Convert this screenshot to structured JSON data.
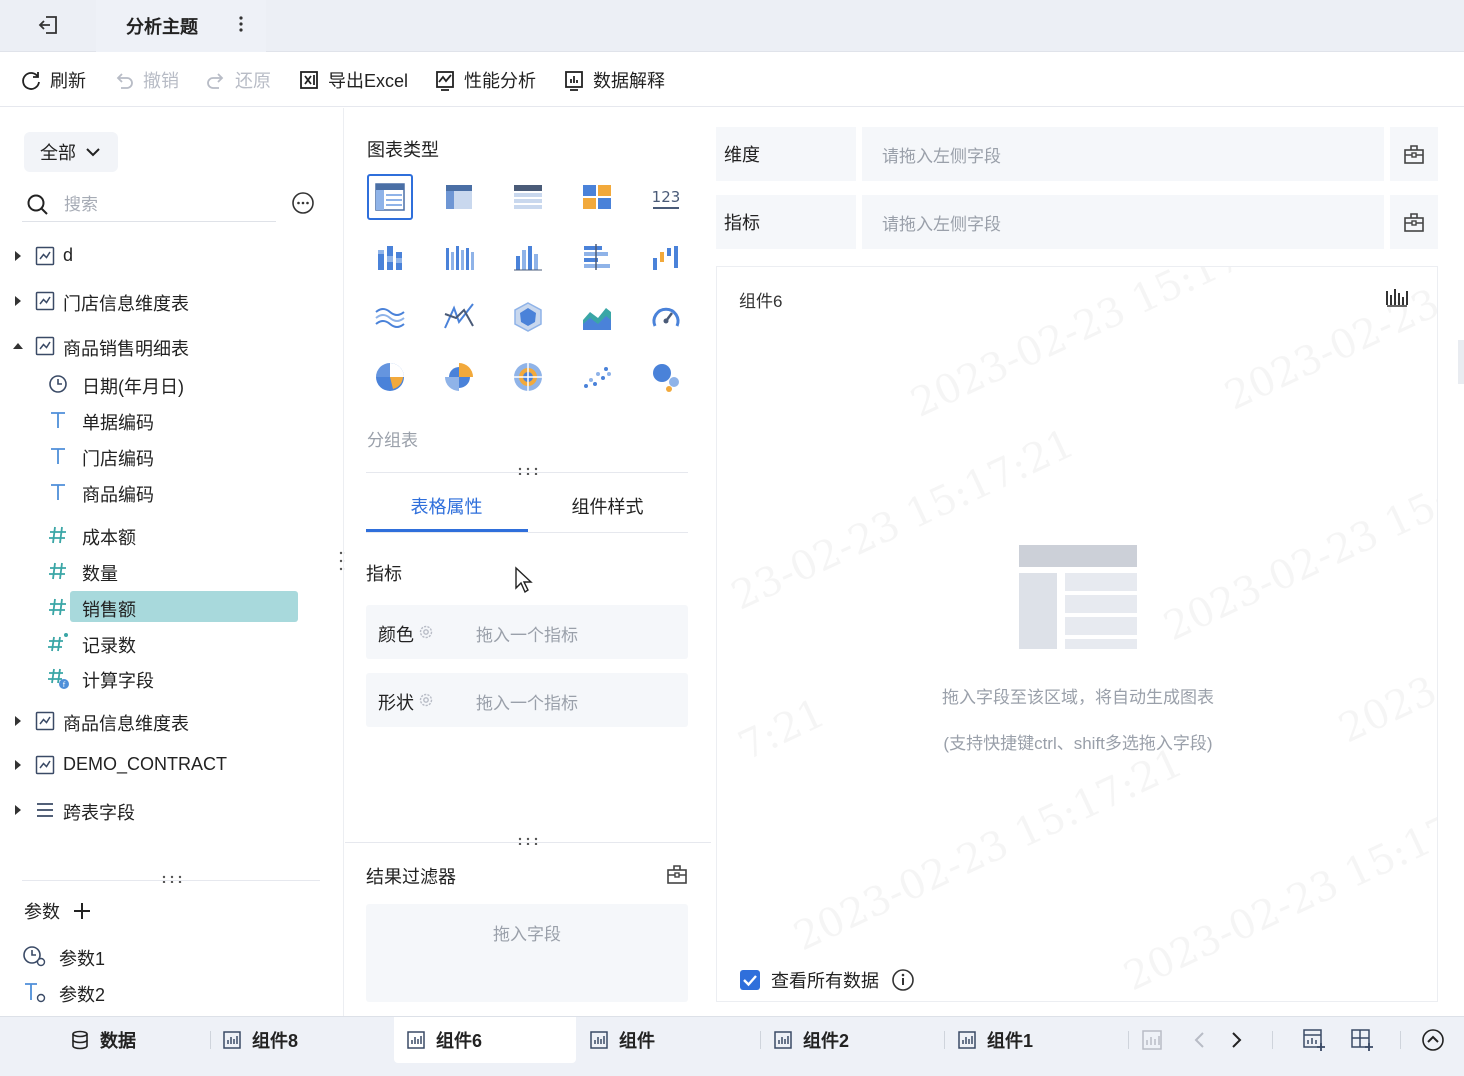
{
  "titlebar": {
    "theme_tab": "分析主题"
  },
  "toolbar": {
    "refresh": "刷新",
    "undo": "撤销",
    "redo": "还原",
    "export_excel": "导出Excel",
    "performance": "性能分析",
    "data_explain": "数据解释"
  },
  "left": {
    "scope": "全部",
    "search_placeholder": "搜索",
    "tables": [
      {
        "label": "d",
        "expanded": false
      },
      {
        "label": "门店信息维度表",
        "expanded": false
      },
      {
        "label": "商品销售明细表",
        "expanded": true
      },
      {
        "label": "商品信息维度表",
        "expanded": false
      },
      {
        "label": "DEMO_CONTRACT",
        "expanded": false
      },
      {
        "label": "跨表字段",
        "expanded": false
      }
    ],
    "fields": [
      {
        "label": "日期(年月日)",
        "icon": "clock-icon"
      },
      {
        "label": "单据编码",
        "icon": "text-type-icon"
      },
      {
        "label": "门店编码",
        "icon": "text-type-icon"
      },
      {
        "label": "商品编码",
        "icon": "text-type-icon"
      },
      {
        "label": "成本额",
        "icon": "number-hash-icon"
      },
      {
        "label": "数量",
        "icon": "number-hash-icon"
      },
      {
        "label": "销售额",
        "icon": "number-hash-icon",
        "selected": true
      },
      {
        "label": "记录数",
        "icon": "number-hash-star-icon"
      },
      {
        "label": "计算字段",
        "icon": "calculated-field-icon"
      }
    ],
    "params_title": "参数",
    "params": [
      {
        "label": "参数1",
        "icon": "time-param-icon"
      },
      {
        "label": "参数2",
        "icon": "text-param-icon"
      }
    ]
  },
  "middle": {
    "chart_type_title": "图表类型",
    "chart_types": [
      "grouped-table-icon",
      "cross-table-icon",
      "detail-table-icon",
      "kpi-card-icon",
      "indicator-number-icon",
      "stacked-column-icon",
      "multi-column-icon",
      "column-chart-icon",
      "bar-chart-icon",
      "waterfall-icon",
      "line-chart-icon",
      "range-line-icon",
      "radar-chart-icon",
      "area-chart-icon",
      "gauge-icon",
      "pie-chart-icon",
      "rose-chart-icon",
      "sunburst-icon",
      "scatter-icon",
      "bubble-icon"
    ],
    "selected_chart_name": "分组表",
    "tabs": [
      "表格属性",
      "组件样式"
    ],
    "active_tab": 0,
    "metric_title": "指标",
    "color_label": "颜色",
    "color_placeholder": "拖入一个指标",
    "shape_label": "形状",
    "shape_placeholder": "拖入一个指标",
    "filter_title": "结果过滤器",
    "filter_placeholder": "拖入字段"
  },
  "right": {
    "dimension_label": "维度",
    "dimension_placeholder": "请拖入左侧字段",
    "metric_label": "指标",
    "metric_placeholder": "请拖入左侧字段",
    "component_title": "组件6",
    "empty_main": "拖入字段至该区域，将自动生成图表",
    "empty_sub": "(支持快捷键ctrl、shift多选拖入字段)",
    "view_all_label": "查看所有数据",
    "view_all_checked": true
  },
  "bottom": {
    "tabs": [
      {
        "label": "数据",
        "icon": "database-icon"
      },
      {
        "label": "组件8",
        "icon": "component-chart-icon"
      },
      {
        "label": "组件6",
        "icon": "component-chart-icon",
        "active": true
      },
      {
        "label": "组件",
        "icon": "component-chart-icon"
      },
      {
        "label": "组件2",
        "icon": "component-chart-icon"
      },
      {
        "label": "组件1",
        "icon": "component-chart-icon"
      }
    ]
  },
  "colors": {
    "accent": "#2f6fdb",
    "selected_field_bg": "#a8d9dc",
    "placeholder": "#9aa0aa",
    "panel_bg": "#f5f7fa"
  }
}
